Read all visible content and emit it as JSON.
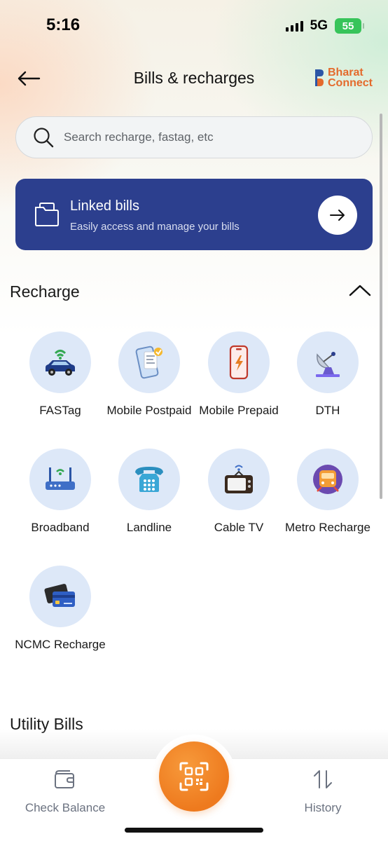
{
  "status_bar": {
    "time": "5:16",
    "network": "5G",
    "battery": "55"
  },
  "header": {
    "title": "Bills & recharges",
    "brand_line1": "Bharat",
    "brand_line2": "Connect"
  },
  "search": {
    "placeholder": "Search recharge, fastag, etc"
  },
  "linked_bills": {
    "title": "Linked bills",
    "subtitle": "Easily access and manage your bills"
  },
  "recharge": {
    "title": "Recharge",
    "items": [
      {
        "label": "FASTag",
        "icon": "fastag-car-icon"
      },
      {
        "label": "Mobile Postpaid",
        "icon": "mobile-postpaid-icon"
      },
      {
        "label": "Mobile Prepaid",
        "icon": "mobile-prepaid-icon"
      },
      {
        "label": "DTH",
        "icon": "satellite-dish-icon"
      },
      {
        "label": "Broadband",
        "icon": "router-icon"
      },
      {
        "label": "Landline",
        "icon": "telephone-icon"
      },
      {
        "label": "Cable TV",
        "icon": "tv-icon"
      },
      {
        "label": "Metro Recharge",
        "icon": "metro-train-icon"
      },
      {
        "label": "NCMC Recharge",
        "icon": "cards-icon"
      }
    ]
  },
  "utility": {
    "title": "Utility Bills"
  },
  "bottom_nav": {
    "check_balance": "Check Balance",
    "history": "History",
    "scan": "qr-scan-icon"
  },
  "colors": {
    "card_blue": "#2c3f8e",
    "accent_orange": "#ee7a1e",
    "tile_bg": "#dde8f8",
    "battery_green": "#37c45a"
  }
}
